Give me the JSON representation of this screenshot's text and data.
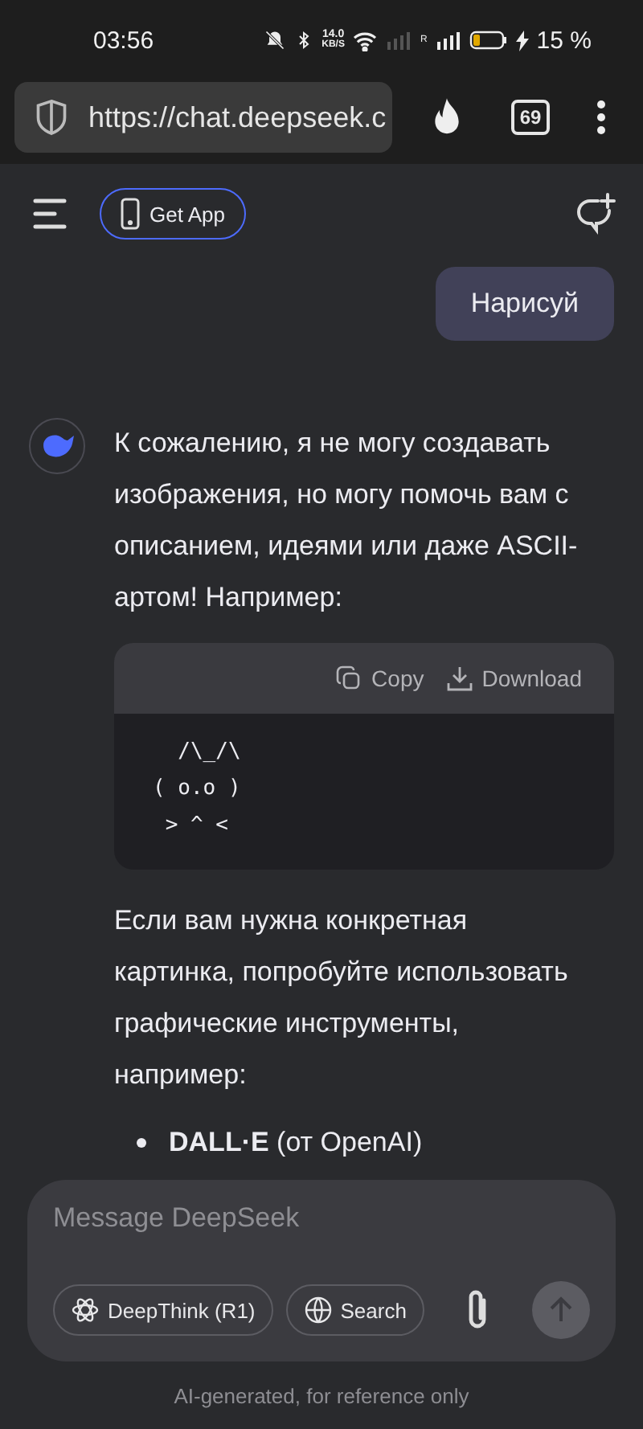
{
  "status_bar": {
    "time": "03:56",
    "net_speed": "14.0",
    "net_unit": "KB/S",
    "sim_label": "R",
    "battery": "15 %"
  },
  "browser": {
    "url": "https://chat.deepseek.c",
    "tab_count": "69"
  },
  "header": {
    "get_app": "Get App"
  },
  "messages": [
    {
      "kind": "user",
      "text": "Нарисуй"
    },
    {
      "kind": "assistant",
      "blocks": [
        {
          "kind": "paragraph",
          "text": "К сожалению, я не могу создавать изображения, но могу помочь вам с описанием, идеями или даже ASCII-артом! Например:"
        },
        {
          "kind": "code",
          "actions": [
            "Copy",
            "Download"
          ],
          "lines": [
            "  /\\_/\\",
            "( o.o )",
            " > ^ <"
          ]
        },
        {
          "kind": "paragraph",
          "text": "Если вам нужна конкретная картинка, попробуйте использовать графические инструменты, например:"
        },
        {
          "kind": "list",
          "items": [
            "**DALL·E** (от OpenAI)"
          ]
        }
      ]
    }
  ],
  "composer": {
    "placeholder": "Message DeepSeek",
    "buttons": [
      {
        "label": "DeepThink (R1)",
        "selected": false
      },
      {
        "label": "Search",
        "selected": false
      }
    ]
  },
  "footer": "AI-generated, for reference only"
}
